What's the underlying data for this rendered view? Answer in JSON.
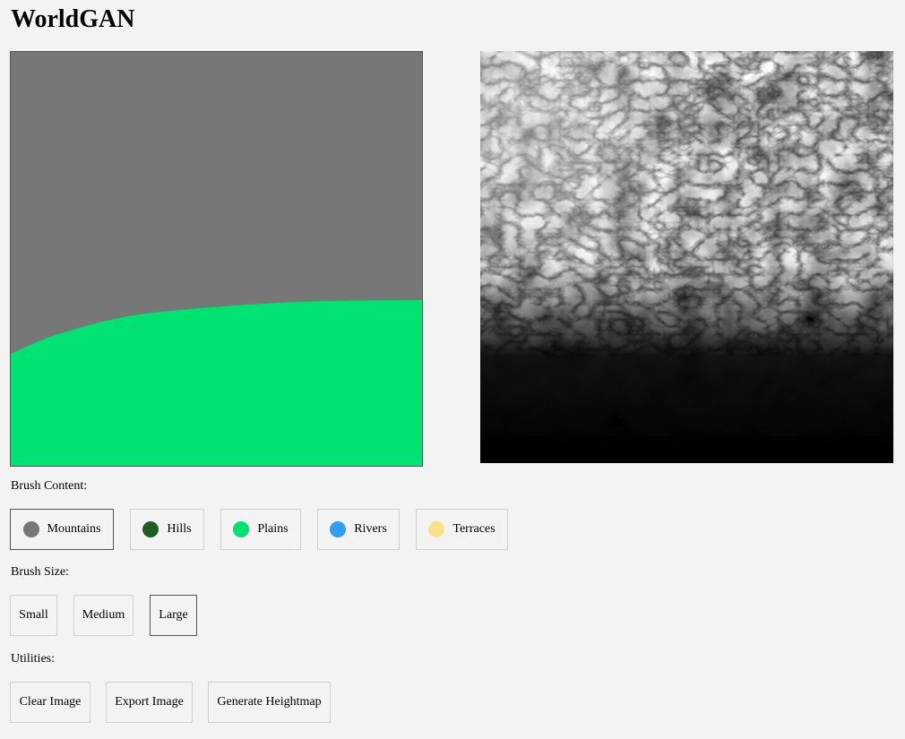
{
  "app": {
    "title": "WorldGAN"
  },
  "brush_content": {
    "label": "Brush Content:",
    "options": [
      {
        "label": "Mountains",
        "color": "#777777",
        "icon": "mountains-swatch-icon",
        "selected": true
      },
      {
        "label": "Hills",
        "color": "#1e5e22",
        "icon": "hills-swatch-icon",
        "selected": false
      },
      {
        "label": "Plains",
        "color": "#00e272",
        "icon": "plains-swatch-icon",
        "selected": false
      },
      {
        "label": "Rivers",
        "color": "#2d9ef0",
        "icon": "rivers-swatch-icon",
        "selected": false
      },
      {
        "label": "Terraces",
        "color": "#fde186",
        "icon": "terraces-swatch-icon",
        "selected": false
      }
    ]
  },
  "brush_size": {
    "label": "Brush Size:",
    "options": [
      {
        "label": "Small",
        "selected": false
      },
      {
        "label": "Medium",
        "selected": false
      },
      {
        "label": "Large",
        "selected": true
      }
    ]
  },
  "utilities": {
    "label": "Utilities:",
    "buttons": [
      {
        "label": "Clear Image"
      },
      {
        "label": "Export Image"
      },
      {
        "label": "Generate Heightmap"
      }
    ]
  },
  "colors": {
    "background": "#f3f3f3",
    "mountains": "#777777",
    "plains": "#00e272"
  }
}
